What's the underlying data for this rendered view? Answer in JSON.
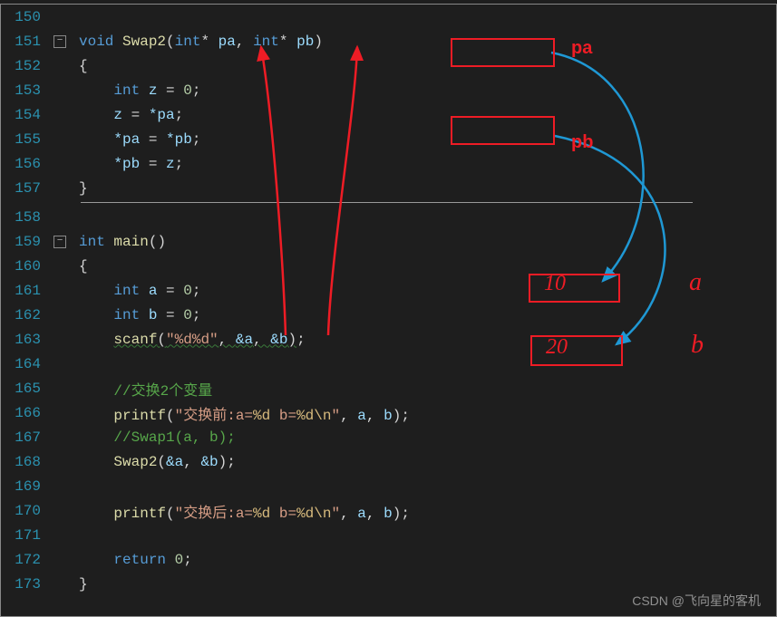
{
  "lines": {
    "l150": "150",
    "l151": "151",
    "l152": "152",
    "l153": "153",
    "l154": "154",
    "l155": "155",
    "l156": "156",
    "l157": "157",
    "l158": "158",
    "l159": "159",
    "l160": "160",
    "l161": "161",
    "l162": "162",
    "l163": "163",
    "l164": "164",
    "l165": "165",
    "l166": "166",
    "l167": "167",
    "l168": "168",
    "l169": "169",
    "l170": "170",
    "l171": "171",
    "l172": "172",
    "l173": "173"
  },
  "code": {
    "void": "void",
    "int": "int",
    "return": "return",
    "swap2": "Swap2",
    "main": "main",
    "scanf": "scanf",
    "printf": "printf",
    "pa": "pa",
    "pb": "pb",
    "starpa": "*pa",
    "starpb": "*pb",
    "z": "z",
    "a": "a",
    "b": "b",
    "ampa": "&a",
    "ampb": "&b",
    "zero": "0",
    "fmtscan": "\"%d%d\"",
    "comment1": "//交换2个变量",
    "comment2": "//Swap1(a, b);",
    "str_before_1": "\"交换前:a=",
    "str_after_1": "\"交换后:a=",
    "pct_d": "%d",
    "str_mid": " b=",
    "str_nl": "\\n",
    "str_close": "\"",
    "lparen": "(",
    "rparen": ")",
    "lbrace": "{",
    "rbrace": "}",
    "comma": ", ",
    "semi": ";",
    "eq": " = ",
    "star": "*",
    "space": " "
  },
  "annotations": {
    "pa_label": "pa",
    "pb_label": "pb",
    "a_label": "a",
    "b_label": "b",
    "ten": "10",
    "twenty": "20"
  },
  "watermark": "CSDN @飞向星的客机",
  "colors": {
    "red": "#ee1c25",
    "blue": "#1f98d4"
  }
}
